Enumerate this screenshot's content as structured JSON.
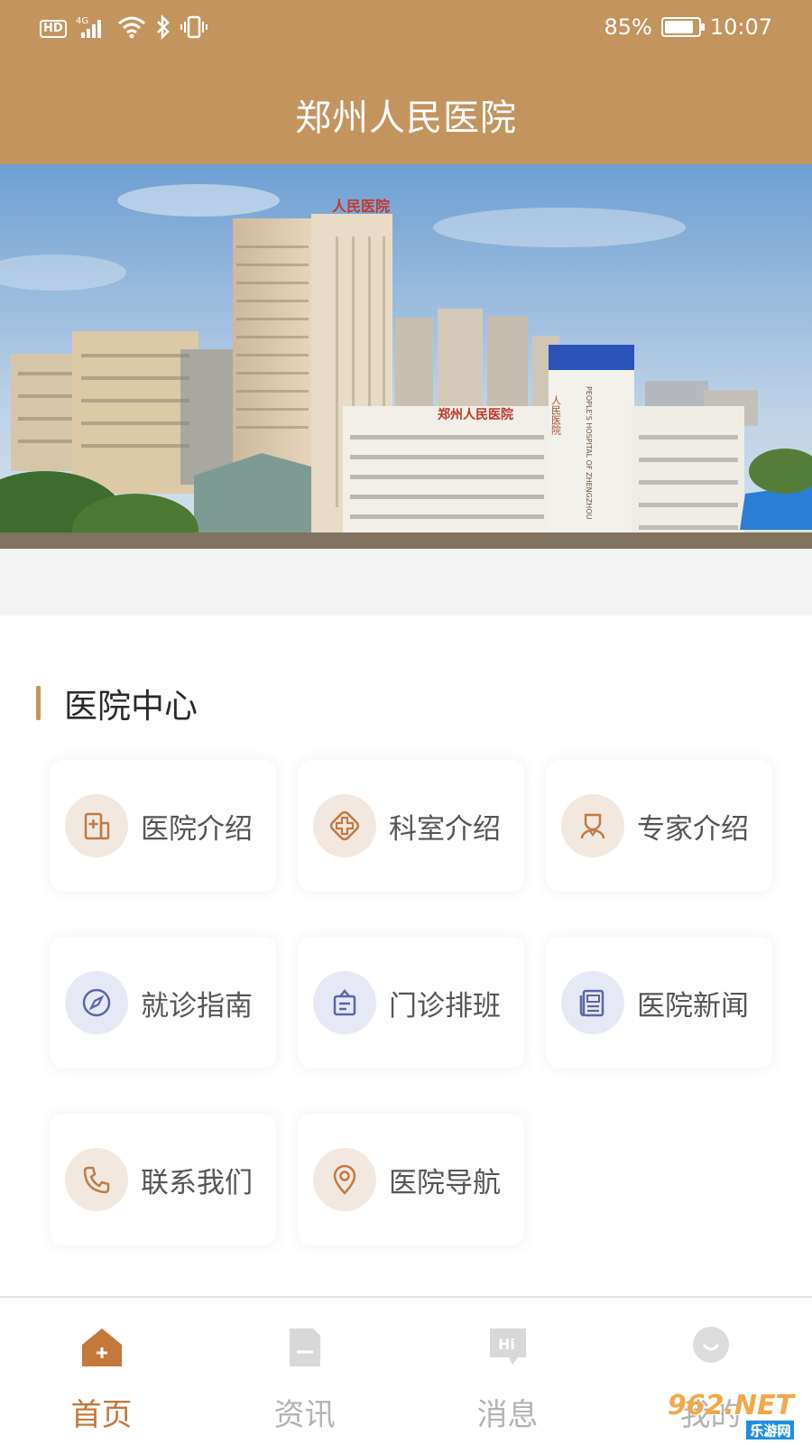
{
  "status": {
    "hd": "HD",
    "net": "4G",
    "battery_percent": "85%",
    "battery_level": 0.85,
    "time": "10:07"
  },
  "app": {
    "title": "郑州人民医院"
  },
  "banner": {
    "sign_building": "人民医院",
    "sign_roof": "郑州人民医院",
    "sign_vertical_cn": "人民医院",
    "sign_vertical_en": "PEOPLE'S HOSPITAL OF ZHENGZHOU"
  },
  "section": {
    "title": "医院中心"
  },
  "cards": [
    {
      "label": "医院介绍",
      "icon": "hospital-building-icon"
    },
    {
      "label": "科室介绍",
      "icon": "medical-cross-icon"
    },
    {
      "label": "专家介绍",
      "icon": "doctor-icon"
    },
    {
      "label": "就诊指南",
      "icon": "compass-icon"
    },
    {
      "label": "门诊排班",
      "icon": "schedule-board-icon"
    },
    {
      "label": "医院新闻",
      "icon": "newspaper-icon"
    },
    {
      "label": "联系我们",
      "icon": "phone-icon"
    },
    {
      "label": "医院导航",
      "icon": "location-pin-icon"
    }
  ],
  "nav": {
    "items": [
      {
        "label": "首页",
        "icon": "home-icon",
        "active": true
      },
      {
        "label": "资讯",
        "icon": "document-icon",
        "active": false
      },
      {
        "label": "消息",
        "icon": "message-hi-icon",
        "active": false
      },
      {
        "label": "我的",
        "icon": "profile-icon",
        "active": false
      }
    ]
  },
  "watermark": {
    "text": "962.NET",
    "sub": "乐游网"
  },
  "colors": {
    "primary": "#c4945f",
    "accent": "#c4783a",
    "icon_warm": "#f2e8df",
    "icon_cool": "#e6e9f5"
  }
}
